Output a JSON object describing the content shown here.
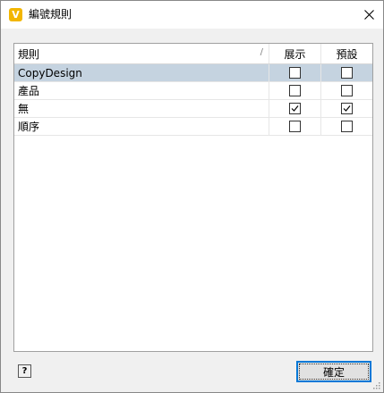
{
  "window": {
    "title": "編號規則",
    "app_icon_glyph": "V",
    "app_icon_color": "#f2b600"
  },
  "grid": {
    "columns": [
      "規則",
      "展示",
      "預設"
    ],
    "sort_indicator": "/",
    "rows": [
      {
        "name": "CopyDesign",
        "show": false,
        "default": false,
        "selected": true
      },
      {
        "name": "產品",
        "show": false,
        "default": false,
        "selected": false
      },
      {
        "name": "無",
        "show": true,
        "default": true,
        "selected": false
      },
      {
        "name": "順序",
        "show": false,
        "default": false,
        "selected": false
      }
    ],
    "selected_color": "#c5d3e0"
  },
  "footer": {
    "help_label": "?",
    "ok_label": "確定",
    "accent": "#0078d7"
  }
}
